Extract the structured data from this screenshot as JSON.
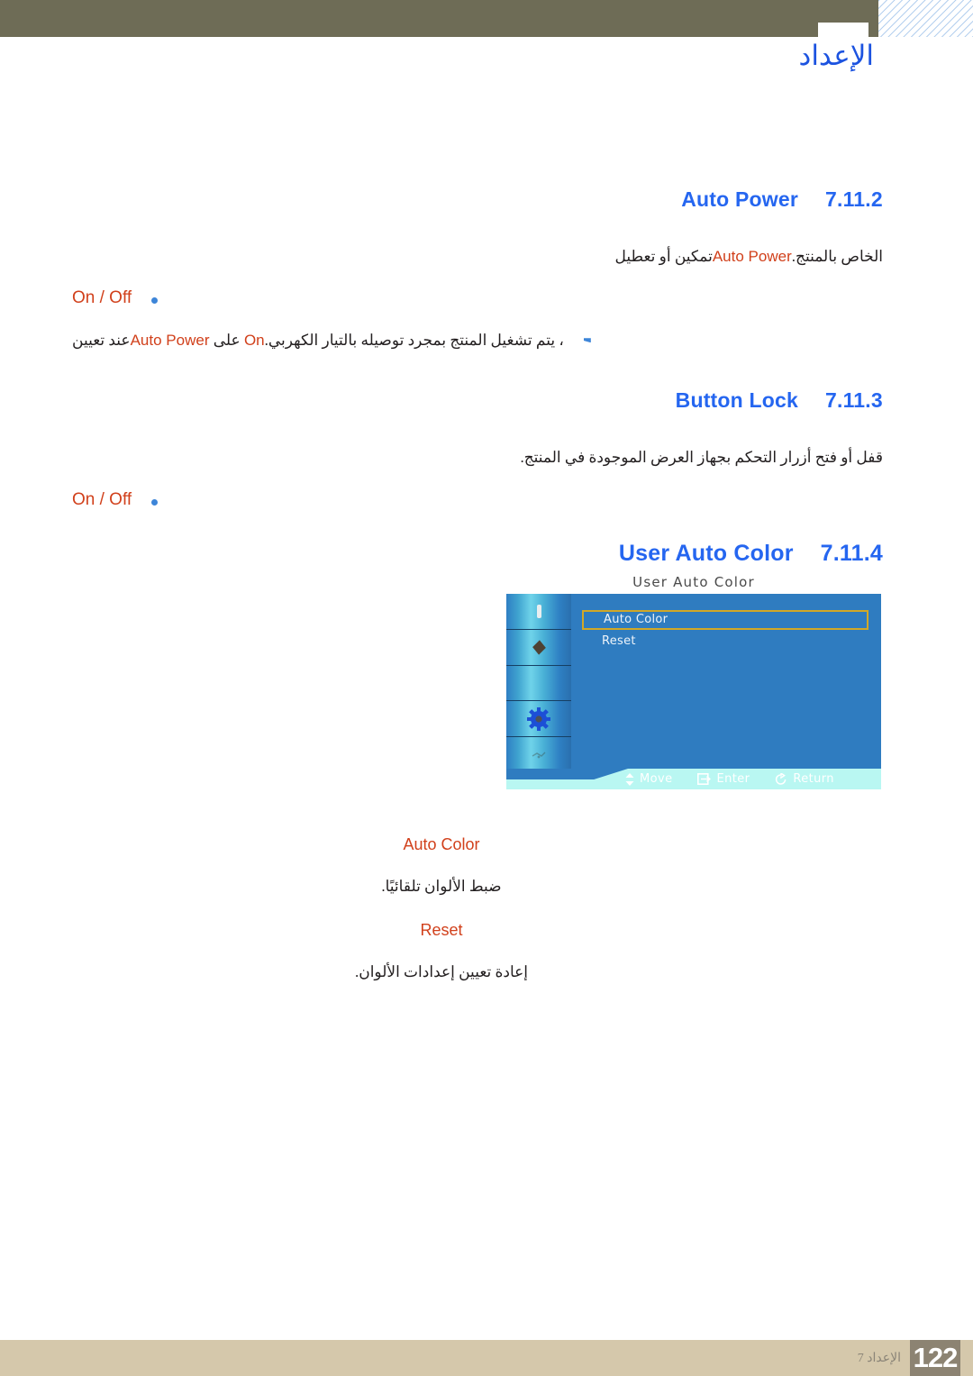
{
  "header": {
    "title": "الإعداد"
  },
  "sections": [
    {
      "number": "7.11.2",
      "title": "Auto Power",
      "paragraph_pre": "تمكين أو تعطيل ",
      "paragraph_term": "Auto Power",
      "paragraph_post": " الخاص بالمنتج.",
      "options_label": "On / Off",
      "note_pre": "عند تعيين ",
      "note_term1": "Auto Power",
      "note_mid": " على ",
      "note_term2": "On",
      "note_post": "، يتم تشغيل المنتج بمجرد توصيله بالتيار الكهربي."
    },
    {
      "number": "7.11.3",
      "title": "Button Lock",
      "paragraph": "قفل أو فتح أزرار التحكم بجهاز العرض الموجودة في المنتج.",
      "options_label": "On / Off"
    },
    {
      "number": "7.11.4",
      "title": "User Auto Color"
    }
  ],
  "osd": {
    "caption": "User Auto Color",
    "menu_items": [
      {
        "label": "Auto Color",
        "selected": true
      },
      {
        "label": "Reset",
        "selected": false
      }
    ],
    "sidebar_icons": [
      "brightness-bar-icon",
      "picture-diamond-icon",
      "blank-icon",
      "settings-gear-icon",
      "info-faint-icon"
    ],
    "footer_hints": [
      {
        "icon": "updown-arrow-icon",
        "label": "Move"
      },
      {
        "icon": "enter-key-icon",
        "label": "Enter"
      },
      {
        "icon": "return-arrow-icon",
        "label": "Return"
      }
    ],
    "colors": {
      "panel_blue": "#2f7cc0",
      "highlight_gold": "#d1a827",
      "footer_cyan": "#b9f7f2"
    }
  },
  "sub_items": [
    {
      "title": "Auto Color",
      "description": "ضبط الألوان تلقائيًا."
    },
    {
      "title": "Reset",
      "description": "إعادة تعيين إعدادات الألوان."
    }
  ],
  "footer": {
    "label": "الإعداد 7",
    "page_number": "122"
  },
  "colors": {
    "heading_blue": "#2566f0",
    "term_orange": "#d1401b",
    "header_olive": "#6e6c56",
    "footer_tan": "#d5c8ab",
    "page_box": "#8c8372"
  }
}
